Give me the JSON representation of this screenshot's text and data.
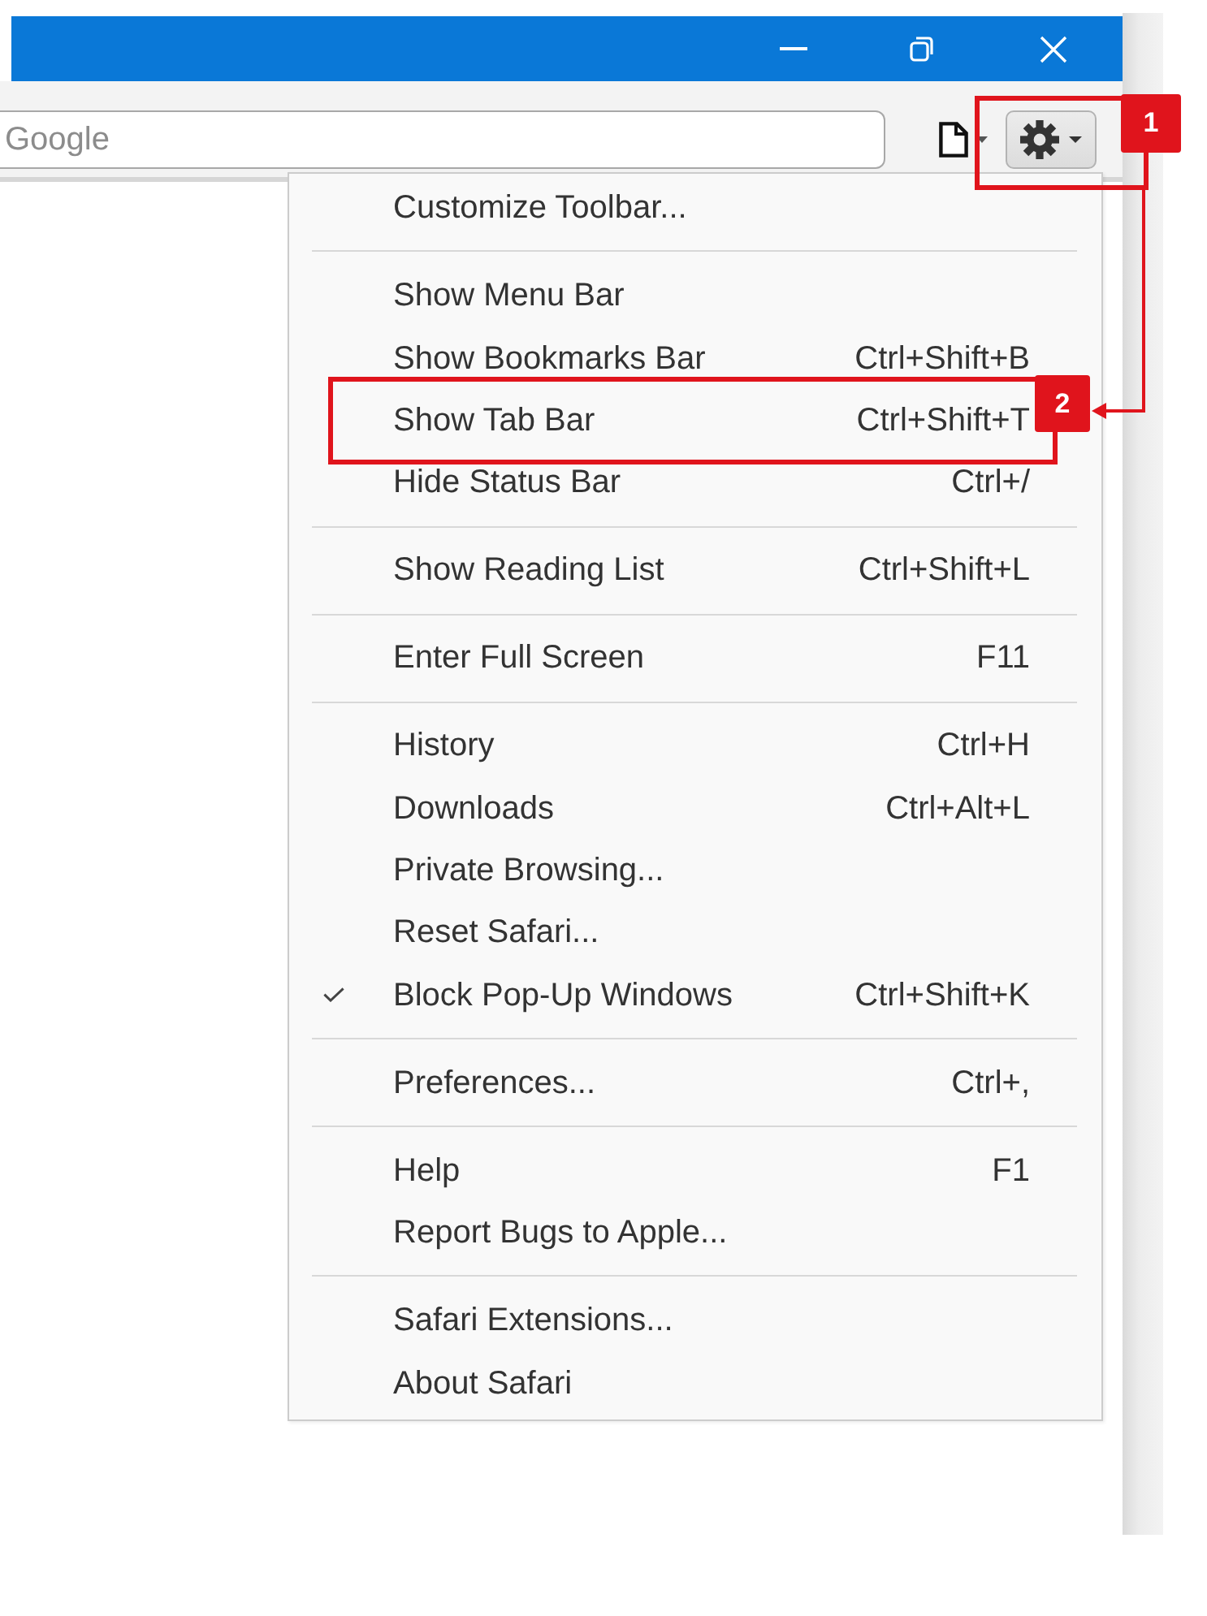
{
  "toolbar": {
    "search": {
      "placeholder": "Google"
    }
  },
  "menu": {
    "items": [
      {
        "kind": "item",
        "label": "Customize Toolbar...",
        "checked": false
      },
      {
        "kind": "separator"
      },
      {
        "kind": "item",
        "label": "Show Menu Bar",
        "checked": false
      },
      {
        "kind": "item",
        "label": "Show Bookmarks Bar",
        "shortcut": "Ctrl+Shift+B",
        "checked": false
      },
      {
        "kind": "item",
        "label": "Show Tab Bar",
        "shortcut": "Ctrl+Shift+T",
        "checked": false
      },
      {
        "kind": "item",
        "label": "Hide Status Bar",
        "shortcut": "Ctrl+/",
        "checked": false
      },
      {
        "kind": "separator"
      },
      {
        "kind": "item",
        "label": "Show Reading List",
        "shortcut": "Ctrl+Shift+L",
        "checked": false
      },
      {
        "kind": "separator"
      },
      {
        "kind": "item",
        "label": "Enter Full Screen",
        "shortcut": "F11",
        "checked": false
      },
      {
        "kind": "separator"
      },
      {
        "kind": "item",
        "label": "History",
        "shortcut": "Ctrl+H",
        "checked": false
      },
      {
        "kind": "item",
        "label": "Downloads",
        "shortcut": "Ctrl+Alt+L",
        "checked": false
      },
      {
        "kind": "item",
        "label": "Private Browsing...",
        "checked": false
      },
      {
        "kind": "item",
        "label": "Reset Safari...",
        "checked": false
      },
      {
        "kind": "item",
        "label": "Block Pop-Up Windows",
        "shortcut": "Ctrl+Shift+K",
        "checked": true
      },
      {
        "kind": "separator"
      },
      {
        "kind": "item",
        "label": "Preferences...",
        "shortcut": "Ctrl+,",
        "checked": false
      },
      {
        "kind": "separator"
      },
      {
        "kind": "item",
        "label": "Help",
        "shortcut": "F1",
        "checked": false
      },
      {
        "kind": "item",
        "label": "Report Bugs to Apple...",
        "checked": false
      },
      {
        "kind": "separator"
      },
      {
        "kind": "item",
        "label": "Safari Extensions...",
        "checked": false
      },
      {
        "kind": "item",
        "label": "About Safari",
        "checked": false
      }
    ]
  },
  "annotations": [
    {
      "label": "1"
    },
    {
      "label": "2"
    }
  ]
}
